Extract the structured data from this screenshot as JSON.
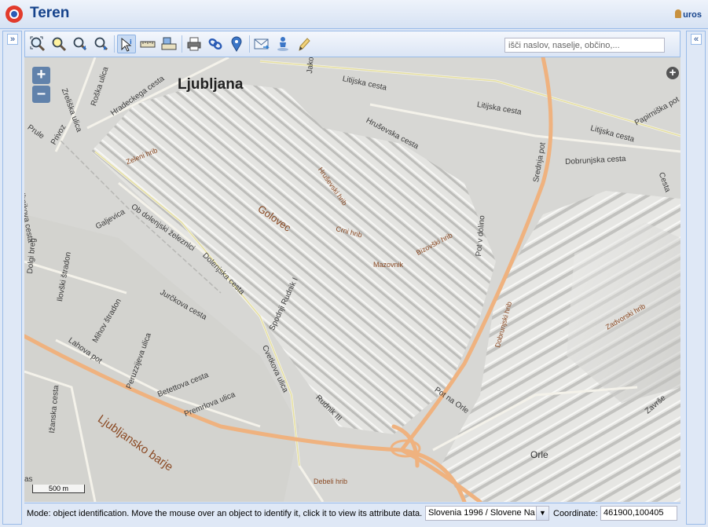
{
  "app": {
    "title": "Teren",
    "user": "uros"
  },
  "toolbar": {
    "search_placeholder": "išči naslov, naselje, občino,...",
    "tools": [
      "zoom-extent-icon",
      "zoom-box-icon",
      "zoom-previous-icon",
      "zoom-next-icon",
      "identify-icon",
      "measure-distance-icon",
      "measure-area-icon",
      "print-icon",
      "link-icon",
      "location-pin-icon",
      "email-icon",
      "user-location-icon",
      "edit-pencil-icon"
    ]
  },
  "map": {
    "zoom_in": "+",
    "zoom_out": "–",
    "expand": "+",
    "scale": "500 m",
    "labels": {
      "ljubljana": "Ljubljana",
      "golovec": "Golovec",
      "ljubljansko_barje": "Ljubljansko barje",
      "orle": "Orle",
      "zelen_hrib": "Zeleni hrib",
      "hrusevski_hrib": "Hruševski hrib",
      "crni_hrib": "Crni hrib",
      "bizovski_hrib": "Bizovški hrib",
      "mazovnik": "Mazovnik",
      "dobrunjski_hrib": "Dobrunjski hrib",
      "zadvorski_hrib": "Zadvorski hrib",
      "debeli_hrib": "Debeli hrib",
      "roska_ulica": "Roška ulica",
      "zreliska_ulica": "Zreliška ulica",
      "hradeckega_cesta": "Hradeckega cesta",
      "litijska_cesta_1": "Litijska cesta",
      "litijska_cesta_2": "Litijska cesta",
      "litijska_cesta_3": "Litijska cesta",
      "hrusevska_cesta": "Hruševska cesta",
      "srednja_pot": "Srednja pot",
      "papirniska_pot": "Papirniška pot",
      "dobrunjska_cesta": "Dobrunjska cesta",
      "cesta_edge": "Cesta",
      "jakopiceva": "Jako",
      "prule": "Prule",
      "privoz": "Privoz",
      "ob_dolenjski": "Ob dolenjski železnici",
      "galjevica": "Galjevica",
      "dolenjska_cesta": "Dolenjska cesta",
      "spodnji_rudnik": "Spodnji Rudnik I",
      "pot_v_dolino": "Pot v dolino",
      "jurckova_cesta": "Jurčkova cesta",
      "mihov_stradon": "Mihov štradon",
      "ilovski_stradon": "Ilovški štradon",
      "dolgi_breg": "Dolgi breg",
      "ihnikova_cesta": "Ihnikova cesta",
      "lahova_pot": "Lahova pot",
      "peruzzijeva_ulica": "Peruzzijeva ulica",
      "betettova_cesta": "Betettova cesta",
      "premrlova_ulica": "Premrlova ulica",
      "cvetkova_ulica": "Cvetkova ulica",
      "rudnik_iii": "Rudnik III",
      "pot_na_orle": "Pot na Orle",
      "izanska_cesta": "Ižanska cesta",
      "zavrsje": "Završe",
      "as_edge": "as"
    }
  },
  "statusbar": {
    "mode_text": "Mode: object identification. Move the mouse over an object to identify it, click it to view its attribute data.",
    "crs": "Slovenia 1996 / Slovene Na",
    "coord_label": "Coordinate:",
    "coord_value": "461900,100405"
  },
  "colors": {
    "accent": "#15428b",
    "border": "#99bbe8",
    "motorway": "#f2b682"
  }
}
